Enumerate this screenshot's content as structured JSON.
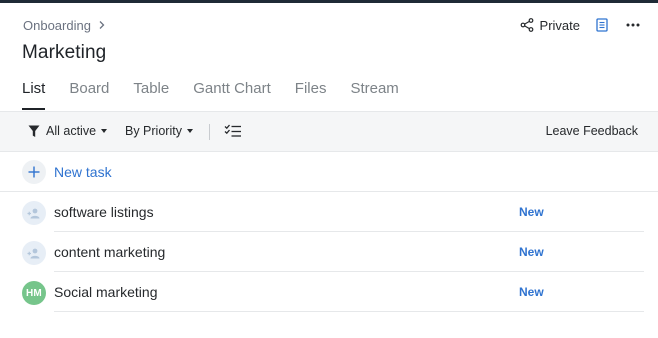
{
  "breadcrumb": {
    "label": "Onboarding"
  },
  "page": {
    "title": "Marketing"
  },
  "header": {
    "private_label": "Private"
  },
  "tabs": [
    {
      "label": "List",
      "active": true
    },
    {
      "label": "Board",
      "active": false
    },
    {
      "label": "Table",
      "active": false
    },
    {
      "label": "Gantt Chart",
      "active": false
    },
    {
      "label": "Files",
      "active": false
    },
    {
      "label": "Stream",
      "active": false
    }
  ],
  "toolbar": {
    "filter_label": "All active",
    "sort_label": "By Priority",
    "feedback_label": "Leave Feedback"
  },
  "new_task": {
    "label": "New task"
  },
  "tasks": [
    {
      "name": "software listings",
      "status": "New",
      "assignee": "",
      "avatar": "add-assignee-icon"
    },
    {
      "name": "content marketing",
      "status": "New",
      "assignee": "",
      "avatar": "add-assignee-icon"
    },
    {
      "name": "Social marketing",
      "status": "New",
      "assignee": "HM",
      "avatar_color": "#76c58b"
    }
  ],
  "colors": {
    "accent": "#2f73d0",
    "topbar": "#1f2a36"
  }
}
